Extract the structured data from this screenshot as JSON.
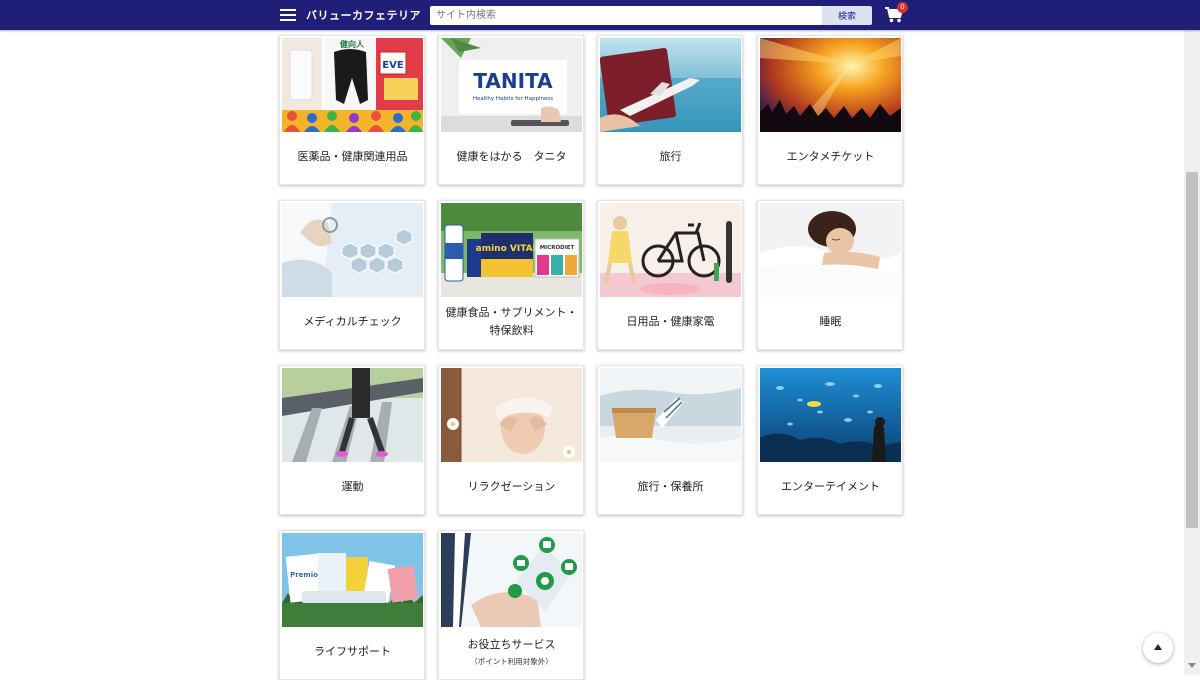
{
  "header": {
    "brand": "バリューカフェテリア",
    "search_placeholder": "サイト内検索",
    "search_button": "検索",
    "cart_count": "0",
    "bg_color": "#1f1f7a"
  },
  "categories": [
    {
      "label": "医薬品・健康関連用品",
      "image_text": [
        "健向人",
        "EVE"
      ]
    },
    {
      "label": "健康をはかる　タニタ",
      "image_text": [
        "TANITA",
        "Healthy Habits for Happiness"
      ]
    },
    {
      "label": "旅行"
    },
    {
      "label": "エンタメチケット"
    },
    {
      "label": "メディカルチェック"
    },
    {
      "label": "健康食品・サプリメント・特保飲料",
      "image_text": [
        "amino VITAL",
        "MICRODIET"
      ]
    },
    {
      "label": "日用品・健康家電"
    },
    {
      "label": "睡眠"
    },
    {
      "label": "運動"
    },
    {
      "label": "リラクゼーション"
    },
    {
      "label": "旅行・保養所"
    },
    {
      "label": "エンターテイメント"
    },
    {
      "label": "ライフサポート",
      "image_text": [
        "Premio"
      ]
    },
    {
      "label": "お役立ちサービス",
      "sublabel": "（ポイント利用対象外）"
    }
  ],
  "icons": {
    "menu": "hamburger-menu-icon",
    "cart": "cart-icon",
    "to_top": "arrow-up-icon"
  }
}
